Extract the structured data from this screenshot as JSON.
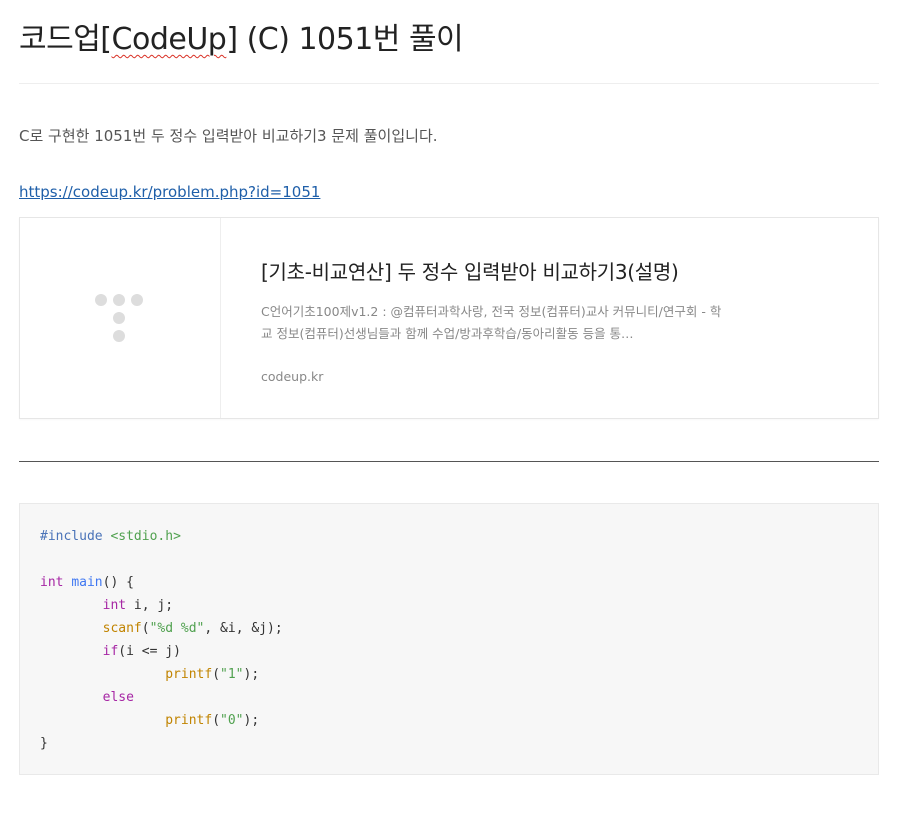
{
  "post": {
    "title_prefix": "코드업[",
    "title_spell": "CodeUp",
    "title_suffix": "] (C) 1051번 풀이",
    "intro": "C로 구현한 1051번 두 정수 입력받아 비교하기3 문제 풀이입니다.",
    "link_text": "https://codeup.kr/problem.php?id=1051"
  },
  "og_card": {
    "thumbnail_icon": "dots-logo-icon",
    "title": "[기초-비교연산] 두 정수 입력받아 비교하기3(설명)",
    "description": "C언어기초100제v1.2 : @컴퓨터과학사랑, 전국 정보(컴퓨터)교사 커뮤니티/연구회 - 학교 정보(컴퓨터)선생님들과 함께 수업/방과후학습/동아리활동 등을 통…",
    "domain": "codeup.kr"
  },
  "code": {
    "l1_meta": "#include",
    "l1_str": "<stdio.h>",
    "l3_type": "int",
    "l3_fn": "main",
    "l3_rest": "() {",
    "l4_type": "int",
    "l4_rest": " i, j;",
    "l5_fn": "scanf",
    "l5_open": "(",
    "l5_str": "\"%d %d\"",
    "l5_rest": ", &i, &j);",
    "l6_kw": "if",
    "l6_rest": "(i <= j)",
    "l7_fn": "printf",
    "l7_open": "(",
    "l7_str": "\"1\"",
    "l7_rest": ");",
    "l8_kw": "else",
    "l9_fn": "printf",
    "l9_open": "(",
    "l9_str": "\"0\"",
    "l9_rest": ");",
    "l10": "}"
  },
  "colors": {
    "link": "#1f5fa9",
    "code_bg": "#f7f7f7",
    "thumb_dots": "#dddddd"
  }
}
